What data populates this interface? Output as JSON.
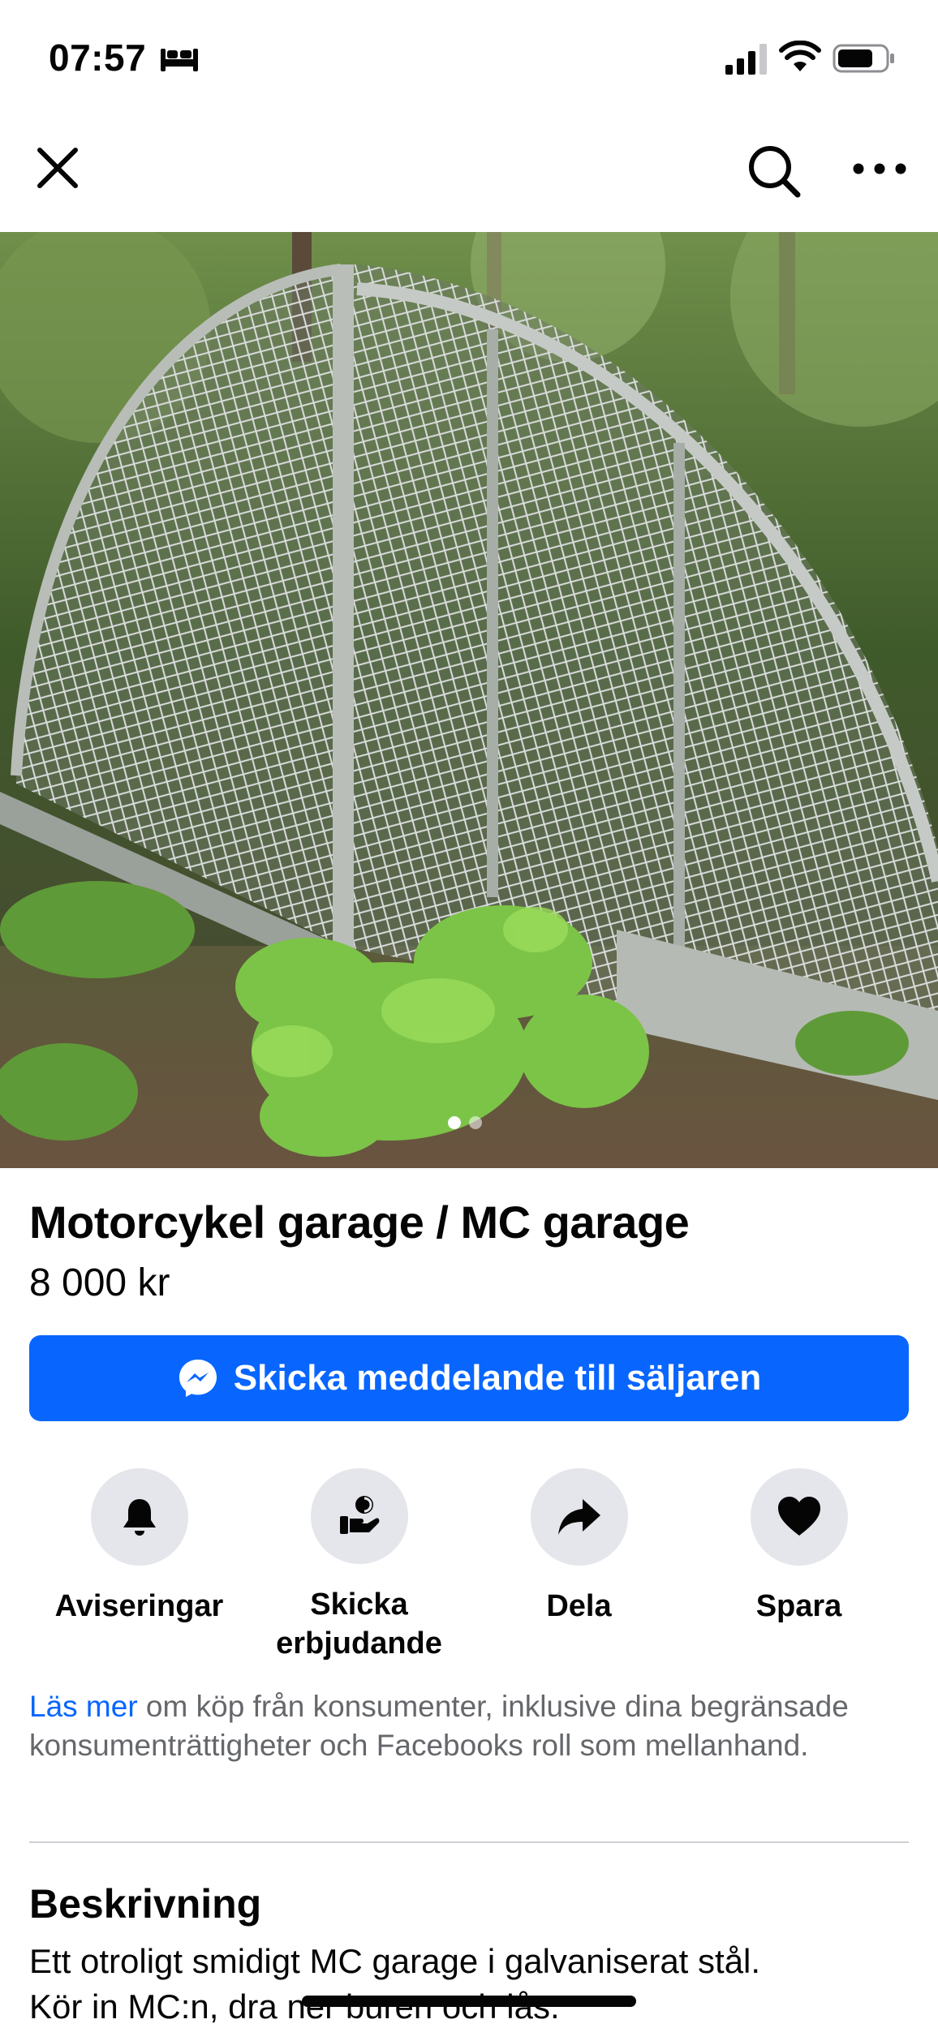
{
  "status_bar": {
    "time": "07:57",
    "icons": [
      "bed-icon",
      "signal-icon",
      "wifi-icon",
      "battery-icon"
    ]
  },
  "nav": {
    "icons": [
      "close-icon",
      "search-icon",
      "more-icon"
    ]
  },
  "photo": {
    "image_count": 2,
    "active_index": 0
  },
  "listing": {
    "title": "Motorcykel garage / MC garage",
    "price": "8 000 kr"
  },
  "message_button": {
    "label": "Skicka meddelande till säljaren",
    "icon": "messenger-icon"
  },
  "actions": [
    {
      "label": "Aviseringar",
      "icon": "bell-icon"
    },
    {
      "label": "Skicka erbjudande",
      "icon": "offer-icon"
    },
    {
      "label": "Dela",
      "icon": "share-icon"
    },
    {
      "label": "Spara",
      "icon": "heart-icon"
    }
  ],
  "consumer_info": {
    "link": "Läs mer",
    "text": " om köp från konsumenter, inklusive dina begränsade konsumenträttigheter och Facebooks roll som mellanhand."
  },
  "description": {
    "heading": "Beskrivning",
    "lines": [
      "Ett otroligt smidigt MC garage i galvaniserat stål.",
      "Kör in MC:n, dra ner buren och lås."
    ]
  },
  "colors": {
    "primary": "#0866ff",
    "secondary_text": "#65676b",
    "action_circle": "#e4e6eb"
  }
}
